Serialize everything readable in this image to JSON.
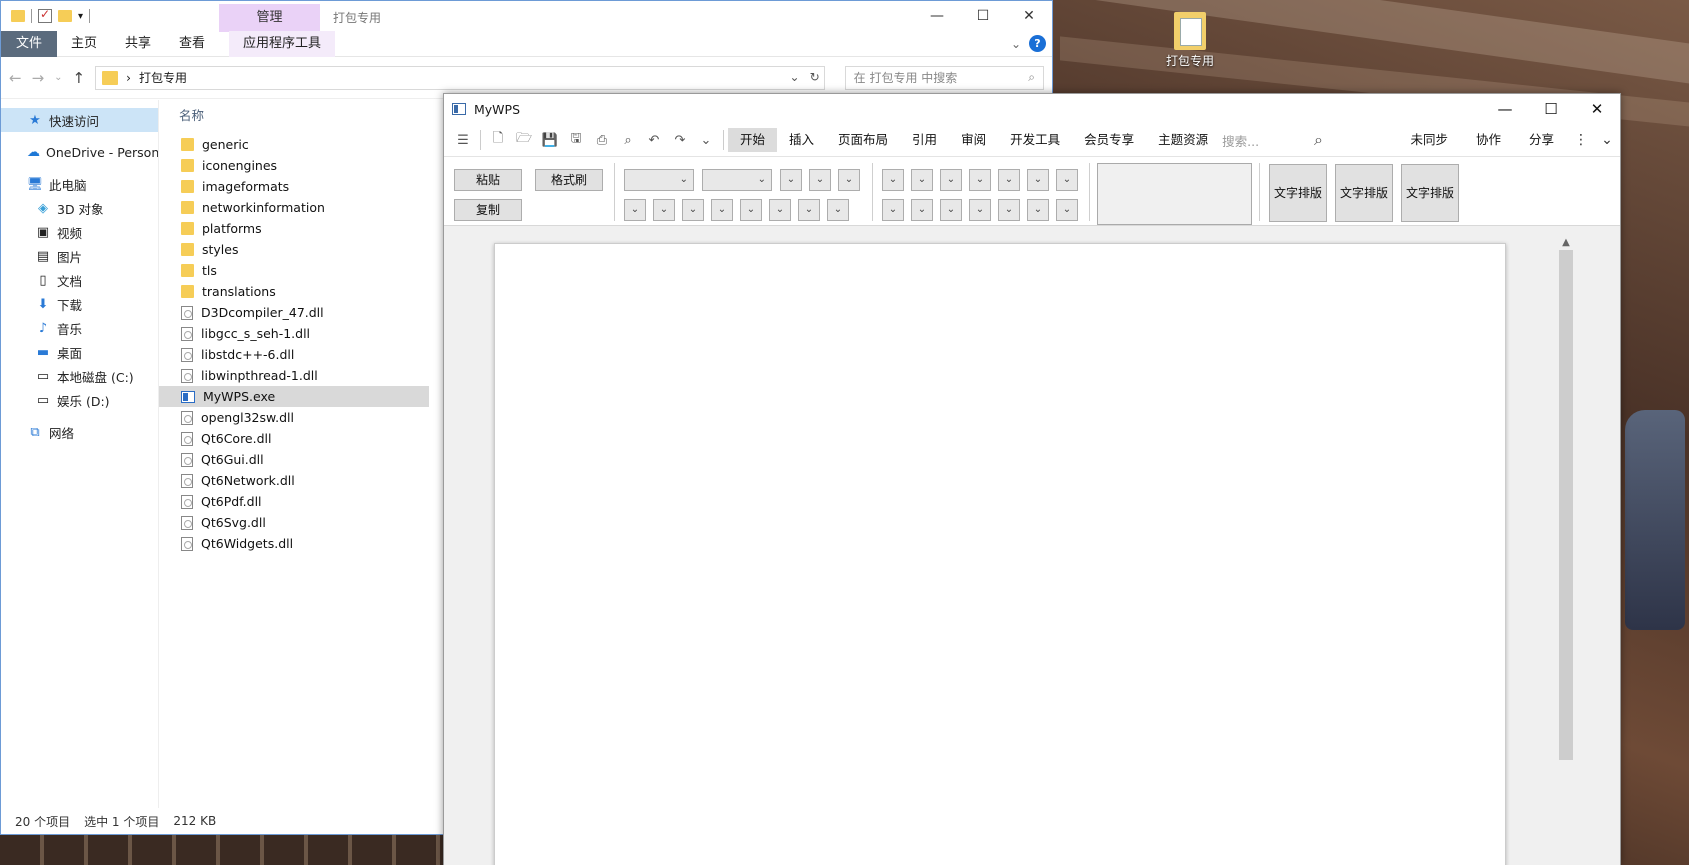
{
  "desktop": {
    "icon_label": "打包专用"
  },
  "explorer": {
    "title": "打包专用",
    "contextual_tab": "管理",
    "ribbon_tabs": [
      "文件",
      "主页",
      "共享",
      "查看",
      "应用程序工具"
    ],
    "address_path": "打包专用",
    "search_placeholder": "在 打包专用 中搜索",
    "nav": {
      "quick_access": "快速访问",
      "onedrive": "OneDrive - Persona",
      "this_pc": "此电脑",
      "items": [
        "3D 对象",
        "视频",
        "图片",
        "文档",
        "下载",
        "音乐",
        "桌面",
        "本地磁盘 (C:)",
        "娱乐 (D:)"
      ],
      "network": "网络"
    },
    "column_name": "名称",
    "files": [
      {
        "name": "generic",
        "type": "folder"
      },
      {
        "name": "iconengines",
        "type": "folder"
      },
      {
        "name": "imageformats",
        "type": "folder"
      },
      {
        "name": "networkinformation",
        "type": "folder"
      },
      {
        "name": "platforms",
        "type": "folder"
      },
      {
        "name": "styles",
        "type": "folder"
      },
      {
        "name": "tls",
        "type": "folder"
      },
      {
        "name": "translations",
        "type": "folder"
      },
      {
        "name": "D3Dcompiler_47.dll",
        "type": "dll"
      },
      {
        "name": "libgcc_s_seh-1.dll",
        "type": "dll"
      },
      {
        "name": "libstdc++-6.dll",
        "type": "dll"
      },
      {
        "name": "libwinpthread-1.dll",
        "type": "dll"
      },
      {
        "name": "MyWPS.exe",
        "type": "exe",
        "selected": true
      },
      {
        "name": "opengl32sw.dll",
        "type": "dll"
      },
      {
        "name": "Qt6Core.dll",
        "type": "dll"
      },
      {
        "name": "Qt6Gui.dll",
        "type": "dll"
      },
      {
        "name": "Qt6Network.dll",
        "type": "dll"
      },
      {
        "name": "Qt6Pdf.dll",
        "type": "dll"
      },
      {
        "name": "Qt6Svg.dll",
        "type": "dll"
      },
      {
        "name": "Qt6Widgets.dll",
        "type": "dll"
      }
    ],
    "status": {
      "count": "20 个项目",
      "selected": "选中 1 个项目",
      "size": "212 KB"
    }
  },
  "wps": {
    "title": "MyWPS",
    "menu_tabs": [
      "开始",
      "插入",
      "页面布局",
      "引用",
      "审阅",
      "开发工具",
      "会员专享",
      "主题资源"
    ],
    "search_placeholder": "搜索...",
    "right_menu": [
      "未同步",
      "协作",
      "分享"
    ],
    "toolbar": {
      "paste": "粘贴",
      "format_painter": "格式刷",
      "copy": "复制",
      "layout_buttons": [
        "文字排版",
        "文字排版",
        "文字排版"
      ]
    }
  }
}
